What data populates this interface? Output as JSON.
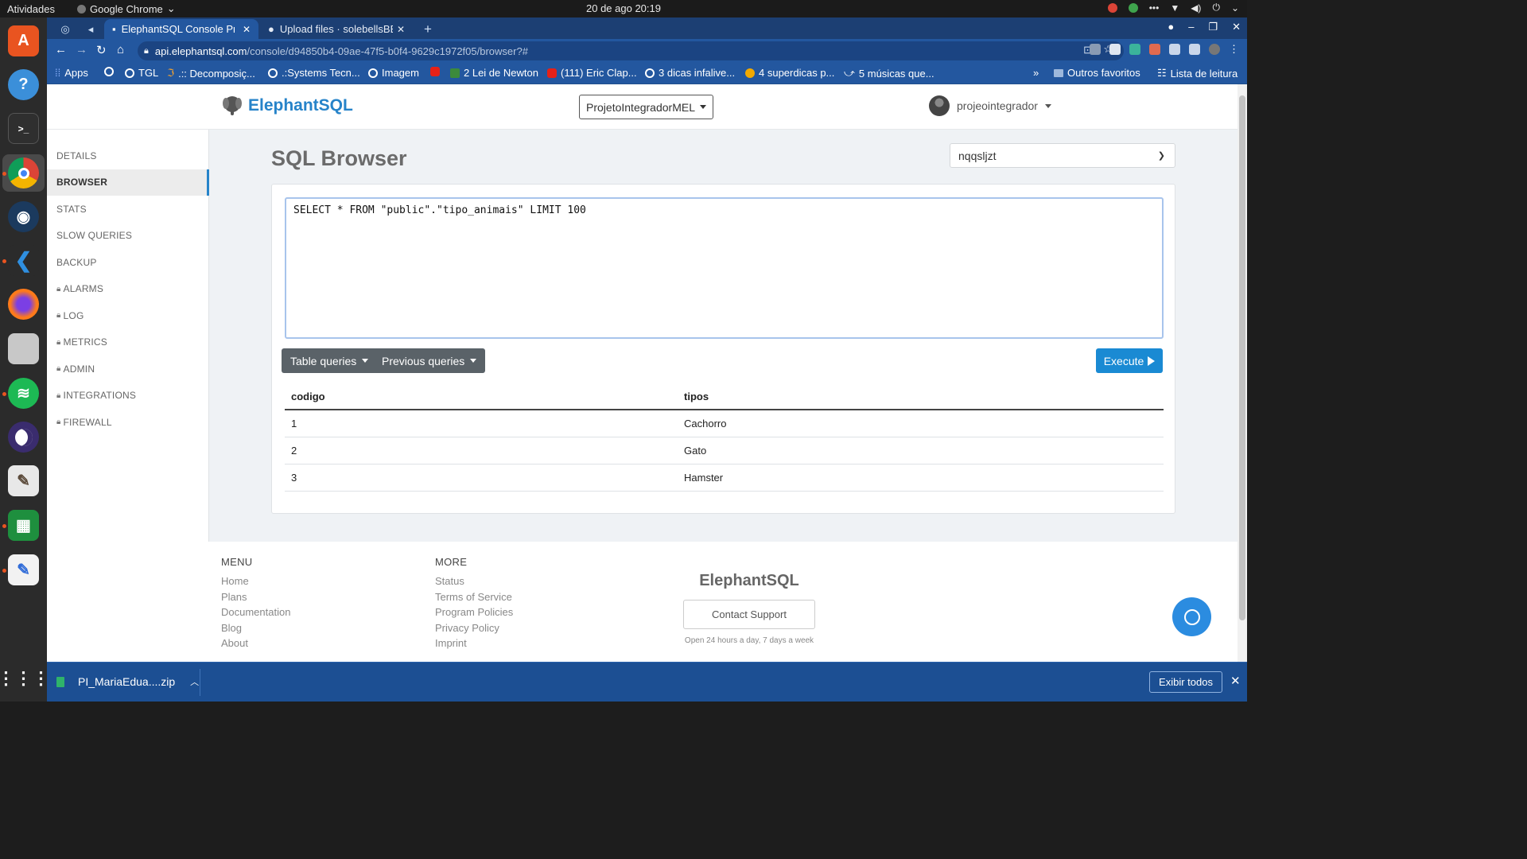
{
  "os": {
    "activities": "Atividades",
    "app_menu": "Google Chrome",
    "clock": "20 de ago  20:19"
  },
  "browser": {
    "tabs": [
      {
        "title": "ElephantSQL Console Pro"
      },
      {
        "title": "Upload files · solebellsBE/"
      }
    ],
    "url_host": "api.elephantsql.com",
    "url_path": "/console/d94850b4-09ae-47f5-b0f4-9629c1972f05/browser?#",
    "bookmarks": [
      "Apps",
      "TGL",
      ".:: Decomposiç...",
      ".:Systems Tecn...",
      "Imagem",
      "2 Lei de Newton",
      "(111) Eric Clap...",
      "3 dicas infalive...",
      "4 superdicas p...",
      "5 músicas que..."
    ],
    "other_bookmarks": "Outros favoritos",
    "reading_list": "Lista de leitura"
  },
  "header": {
    "brand": "ElephantSQL",
    "instance": "ProjetoIntegradorMEL",
    "user": "projeointegrador"
  },
  "sidebar": {
    "items": [
      {
        "label": "DETAILS",
        "locked": false,
        "active": false
      },
      {
        "label": "BROWSER",
        "locked": false,
        "active": true
      },
      {
        "label": "STATS",
        "locked": false,
        "active": false
      },
      {
        "label": "SLOW QUERIES",
        "locked": false,
        "active": false
      },
      {
        "label": "BACKUP",
        "locked": false,
        "active": false
      },
      {
        "label": "ALARMS",
        "locked": true,
        "active": false
      },
      {
        "label": "LOG",
        "locked": true,
        "active": false
      },
      {
        "label": "METRICS",
        "locked": true,
        "active": false
      },
      {
        "label": "ADMIN",
        "locked": true,
        "active": false
      },
      {
        "label": "INTEGRATIONS",
        "locked": true,
        "active": false
      },
      {
        "label": "FIREWALL",
        "locked": true,
        "active": false
      }
    ]
  },
  "main": {
    "title": "SQL Browser",
    "database": "nqqsljzt",
    "query": "SELECT * FROM \"public\".\"tipo_animais\" LIMIT 100",
    "table_queries_label": "Table queries",
    "previous_queries_label": "Previous queries",
    "execute_label": "Execute",
    "results": {
      "columns": [
        "codigo",
        "tipos"
      ],
      "rows": [
        [
          "1",
          "Cachorro"
        ],
        [
          "2",
          "Gato"
        ],
        [
          "3",
          "Hamster"
        ]
      ]
    }
  },
  "footer": {
    "menu_title": "MENU",
    "menu_links": [
      "Home",
      "Plans",
      "Documentation",
      "Blog",
      "About"
    ],
    "more_title": "MORE",
    "more_links": [
      "Status",
      "Terms of Service",
      "Program Policies",
      "Privacy Policy",
      "Imprint"
    ],
    "brand": "ElephantSQL",
    "contact_label": "Contact Support",
    "hours": "Open 24 hours a day, 7 days a week"
  },
  "downloads": {
    "file": "PI_MariaEdua....zip",
    "show_all": "Exibir todos"
  },
  "colors": {
    "brand_blue": "#2683c9",
    "execute_blue": "#1a8ad3",
    "chrome_blue": "#23579f",
    "button_gray": "#5a6268"
  }
}
